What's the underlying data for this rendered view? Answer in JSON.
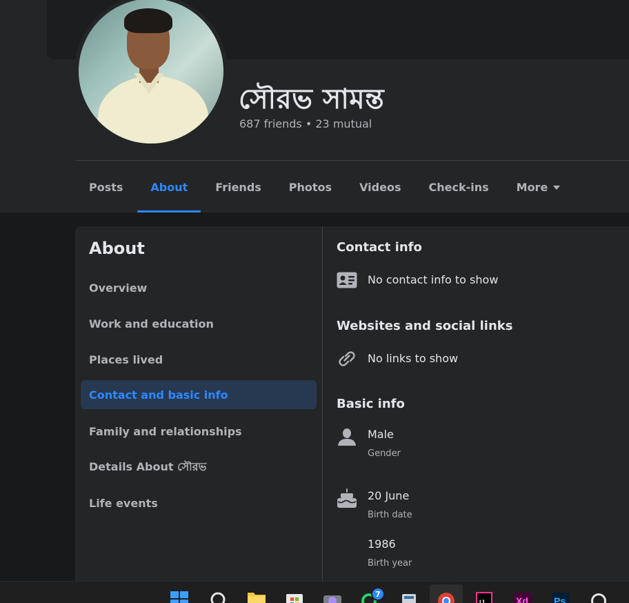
{
  "profile": {
    "name": "সৌরভ সামন্ত",
    "friends_line": "687 friends • 23 mutual"
  },
  "tabs": [
    {
      "label": "Posts"
    },
    {
      "label": "About"
    },
    {
      "label": "Friends"
    },
    {
      "label": "Photos"
    },
    {
      "label": "Videos"
    },
    {
      "label": "Check-ins"
    },
    {
      "label": "More"
    }
  ],
  "about_nav": {
    "title": "About",
    "items": [
      {
        "label": "Overview"
      },
      {
        "label": "Work and education"
      },
      {
        "label": "Places lived"
      },
      {
        "label": "Contact and basic info"
      },
      {
        "label": "Family and relationships"
      },
      {
        "label": "Details About সৌরভ"
      },
      {
        "label": "Life events"
      }
    ]
  },
  "contact": {
    "title": "Contact info",
    "empty_text": "No contact info to show"
  },
  "websites": {
    "title": "Websites and social links",
    "empty_text": "No links to show"
  },
  "basic_info": {
    "title": "Basic info",
    "gender": {
      "value": "Male",
      "label": "Gender"
    },
    "birth_date": {
      "value": "20 June",
      "label": "Birth date"
    },
    "birth_year": {
      "value": "1986",
      "label": "Birth year"
    }
  },
  "taskbar": {
    "whatsapp_badge": "7"
  },
  "colors": {
    "accent": "#2d88ff",
    "background": "#18191a",
    "surface": "#242526"
  }
}
